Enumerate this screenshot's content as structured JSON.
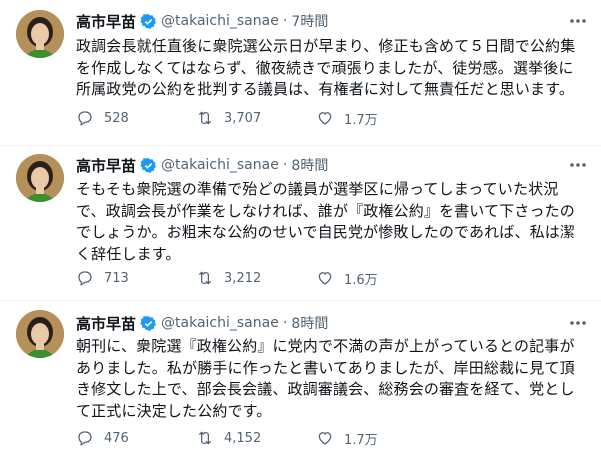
{
  "tweets": [
    {
      "name": "高市早苗",
      "handle": "@takaichi_sanae",
      "separator": "·",
      "time": "7時間",
      "lines": [
        "政調会長就任直後に衆院選公示日が早まり、修正も含めて５日間で公約集",
        "を作成しなくてはならず、徹夜続きで頑張りましたが、徒労感。選挙後に",
        "所属政党の公約を批判する議員は、有権者に対して無責任だと思います。"
      ],
      "replies": "528",
      "retweets": "3,707",
      "likes": "1.7万"
    },
    {
      "name": "高市早苗",
      "handle": "@takaichi_sanae",
      "separator": "·",
      "time": "8時間",
      "lines": [
        "そもそも衆院選の準備で殆どの議員が選挙区に帰ってしまっていた状況",
        "で、政調会長が作業をしなければ、誰が『政権公約』を書いて下さったの",
        "でしょうか。お粗末な公約のせいで自民党が惨敗したのであれば、私は潔",
        "く辞任します。"
      ],
      "replies": "713",
      "retweets": "3,212",
      "likes": "1.6万"
    },
    {
      "name": "高市早苗",
      "handle": "@takaichi_sanae",
      "separator": "·",
      "time": "8時間",
      "lines": [
        "朝刊に、衆院選『政権公約』に党内で不満の声が上がっているとの記事が",
        "ありました。私が勝手に作ったと書いてありましたが、岸田総裁に見て頂",
        "き修文した上で、部会長会議、政調審議会、総務会の審査を経て、党とし",
        "て正式に決定した公約です。"
      ],
      "replies": "476",
      "retweets": "4,152",
      "likes": "1.7万"
    }
  ],
  "icons": {
    "verified": "verified-badge-icon",
    "more": "more-icon",
    "reply": "reply-icon",
    "retweet": "retweet-icon",
    "like": "like-icon",
    "share": "share-icon"
  },
  "colors": {
    "verified": "#1d9bf0",
    "secondary_text": "#536471",
    "divider": "#eff3f4"
  }
}
